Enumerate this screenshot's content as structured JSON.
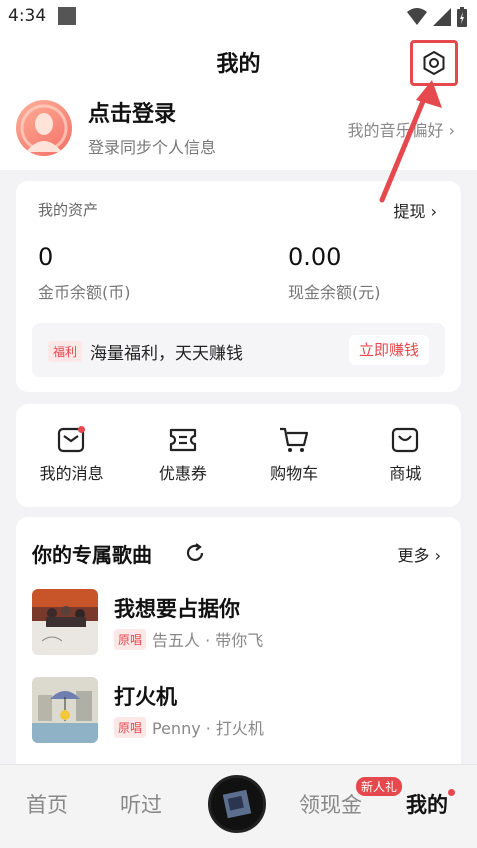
{
  "status_bar": {
    "time": "4:34"
  },
  "header": {
    "title": "我的"
  },
  "profile": {
    "login_title": "点击登录",
    "login_subtitle": "登录同步个人信息",
    "music_pref": "我的音乐偏好 ›"
  },
  "assets": {
    "title": "我的资产",
    "withdraw_label": "提现 ›",
    "coin_value": "0",
    "coin_label": "金币余额(币)",
    "cash_value": "0.00",
    "cash_label": "现金余额(元)",
    "promo_tag": "福利",
    "promo_text": "海量福利，天天赚钱",
    "promo_button": "立即赚钱"
  },
  "actions": [
    {
      "label": "我的消息",
      "icon": "message-icon"
    },
    {
      "label": "优惠券",
      "icon": "coupon-icon"
    },
    {
      "label": "购物车",
      "icon": "cart-icon"
    },
    {
      "label": "商城",
      "icon": "shop-icon"
    }
  ],
  "songs": {
    "title": "你的专属歌曲",
    "more_label": "更多 ›",
    "items": [
      {
        "title": "我想要占据你",
        "tag": "原唱",
        "meta": "告五人 · 带你飞"
      },
      {
        "title": "打火机",
        "tag": "原唱",
        "meta": "Penny · 打火机"
      }
    ]
  },
  "bottom_nav": {
    "items": [
      "首页",
      "听过",
      "领现金",
      "我的"
    ],
    "new_badge": "新人礼"
  },
  "colors": {
    "accent": "#e5484d",
    "background": "#f3f3f5"
  }
}
